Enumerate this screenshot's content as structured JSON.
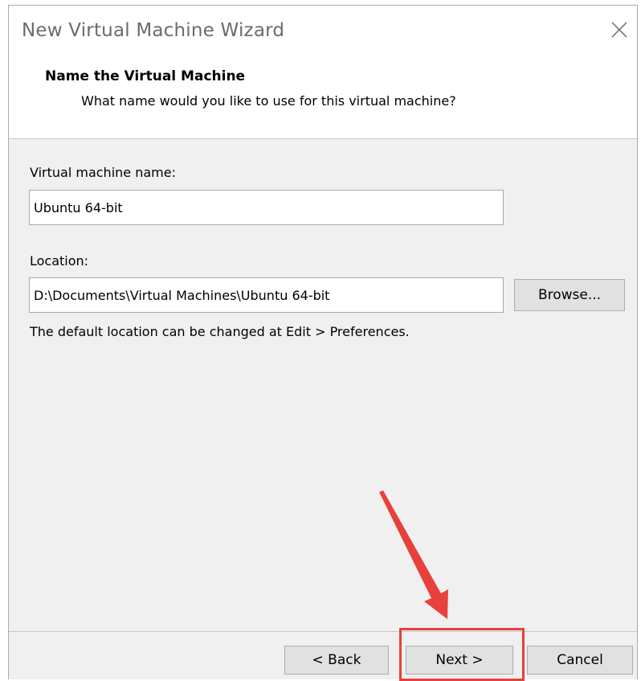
{
  "window": {
    "title": "New Virtual Machine Wizard"
  },
  "header": {
    "title": "Name the Virtual Machine",
    "subtitle": "What name would you like to use for this virtual machine?"
  },
  "form": {
    "vm_name_label": "Virtual machine name:",
    "vm_name_value": "Ubuntu 64-bit",
    "location_label": "Location:",
    "location_value": "D:\\Documents\\Virtual Machines\\Ubuntu 64-bit",
    "browse_label": "Browse...",
    "hint": "The default location can be changed at Edit > Preferences."
  },
  "footer": {
    "back_label": "< Back",
    "next_label": "Next >",
    "cancel_label": "Cancel"
  },
  "icons": {
    "close": "close-icon"
  },
  "colors": {
    "annotation": "#e8403a",
    "button_face": "#e1e1e1",
    "dialog_bg": "#f0f0f0"
  }
}
